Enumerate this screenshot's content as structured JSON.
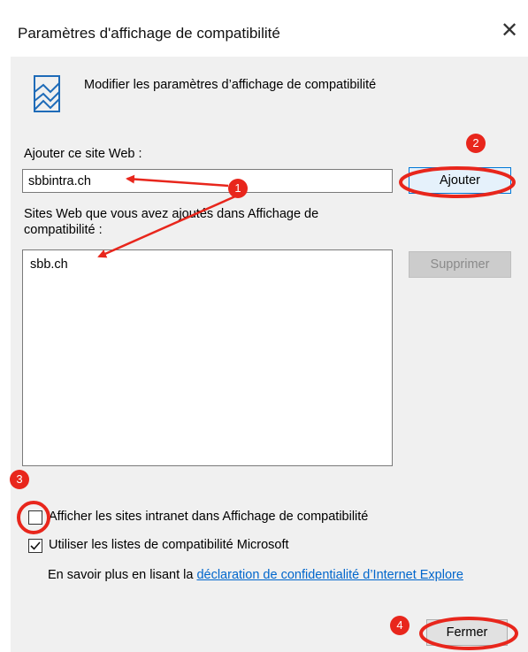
{
  "dialog": {
    "title": "Paramètres d'affichage de compatibilité",
    "close_glyph": "✕",
    "header_text": "Modifier les paramètres d’affichage de compatibilité"
  },
  "add_site": {
    "label": "Ajouter ce site Web :",
    "value": "sbbintra.ch",
    "button": "Ajouter"
  },
  "sites_list": {
    "label_line1": "Sites Web que vous avez ajoutés dans Affichage de",
    "label_line2": "compatibilité :",
    "items": [
      "sbb.ch"
    ],
    "remove_button": "Supprimer"
  },
  "options": {
    "intranet_label": "Afficher les sites intranet dans Affichage de compatibilité",
    "intranet_checked": false,
    "microsoft_label": "Utiliser les listes de compatibilité Microsoft",
    "microsoft_checked": true
  },
  "footer": {
    "learn_prefix": "En savoir plus en lisant la ",
    "learn_link": "déclaration de confidentialité d’Internet Explore",
    "close_button": "Fermer"
  },
  "annotations": {
    "badges": [
      "1",
      "2",
      "3",
      "4"
    ],
    "color": "#e8261c"
  },
  "icons": {
    "header": "compatibility-view-icon",
    "close": "close-icon",
    "check": "check-icon"
  }
}
